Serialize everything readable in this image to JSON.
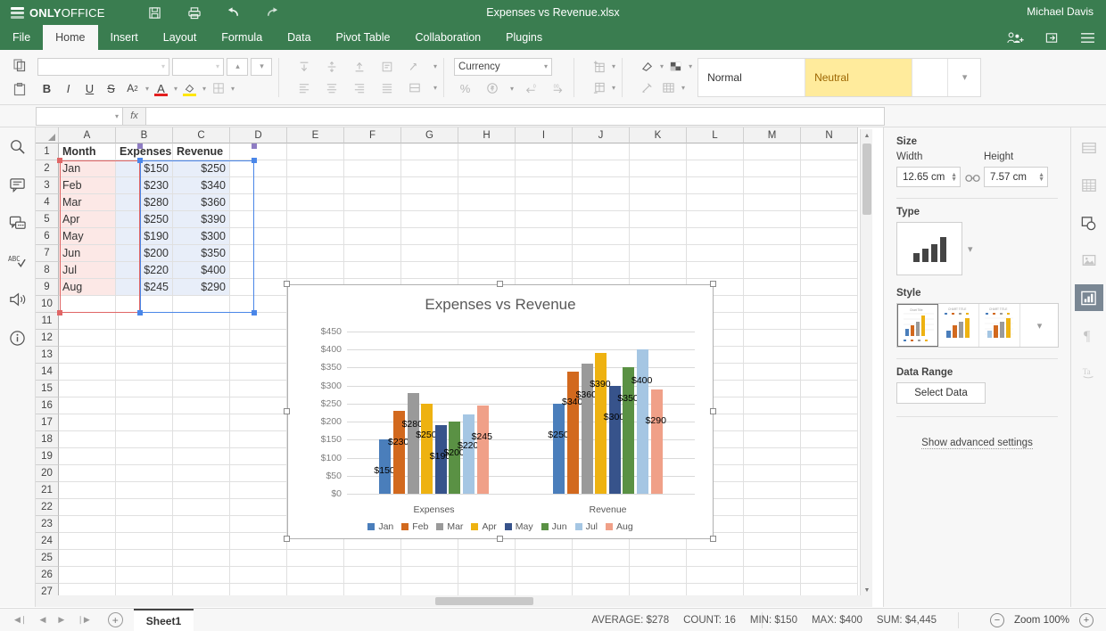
{
  "app": {
    "brand_bold": "ONLY",
    "brand_light": "OFFICE",
    "document_title": "Expenses vs Revenue.xlsx",
    "user_name": "Michael Davis",
    "accent_green": "#3a7d50"
  },
  "quick_access": [
    {
      "name": "save-icon",
      "label": "Save"
    },
    {
      "name": "print-icon",
      "label": "Print"
    },
    {
      "name": "undo-icon",
      "label": "Undo"
    },
    {
      "name": "redo-icon",
      "label": "Redo"
    }
  ],
  "header_actions": [
    {
      "name": "share-users-icon",
      "label": "Share"
    },
    {
      "name": "open-location-icon",
      "label": "Open file location"
    },
    {
      "name": "hamburger-menu-icon",
      "label": "View settings"
    }
  ],
  "menu_tabs": [
    {
      "label": "File",
      "active": false
    },
    {
      "label": "Home",
      "active": true
    },
    {
      "label": "Insert",
      "active": false
    },
    {
      "label": "Layout",
      "active": false
    },
    {
      "label": "Formula",
      "active": false
    },
    {
      "label": "Data",
      "active": false
    },
    {
      "label": "Pivot Table",
      "active": false
    },
    {
      "label": "Collaboration",
      "active": false
    },
    {
      "label": "Plugins",
      "active": false
    }
  ],
  "ribbon": {
    "font_name": "",
    "font_size": "",
    "number_format": "Currency",
    "styles": [
      {
        "label": "Normal",
        "selected": false
      },
      {
        "label": "Neutral",
        "selected": true
      }
    ],
    "buttons": {
      "bold": "B",
      "italic": "I",
      "underline": "U",
      "strikethrough": "S",
      "subscript": "A",
      "font_color": "A",
      "fill_color": "",
      "borders": "",
      "percent": "%",
      "currency": "$"
    }
  },
  "formula_bar": {
    "name_box_value": "",
    "fx_label": "fx",
    "formula_value": ""
  },
  "left_rail": [
    {
      "name": "search-icon",
      "label": "Search"
    },
    {
      "name": "comments-icon",
      "label": "Comments"
    },
    {
      "name": "chat-icon",
      "label": "Chat"
    },
    {
      "name": "spellcheck-icon",
      "label": "Spell checking"
    },
    {
      "name": "feedback-icon",
      "label": "Feedback & Support"
    },
    {
      "name": "about-icon",
      "label": "About"
    }
  ],
  "right_rail": [
    {
      "name": "cell-settings-icon",
      "active": false
    },
    {
      "name": "table-settings-icon",
      "active": false
    },
    {
      "name": "shape-settings-icon",
      "active": false
    },
    {
      "name": "image-settings-icon",
      "active": false
    },
    {
      "name": "chart-settings-icon",
      "active": true
    },
    {
      "name": "paragraph-settings-icon",
      "active": false
    },
    {
      "name": "text-art-settings-icon",
      "active": false
    }
  ],
  "sheet": {
    "columns": [
      "A",
      "B",
      "C",
      "D",
      "E",
      "F",
      "G",
      "H",
      "I",
      "J",
      "K",
      "L",
      "M",
      "N"
    ],
    "rows": [
      1,
      2,
      3,
      4,
      5,
      6,
      7,
      8,
      9,
      10,
      11,
      12,
      13,
      14,
      15,
      16,
      17,
      18,
      19,
      20,
      21,
      22,
      23,
      24,
      25,
      26,
      27
    ],
    "data": [
      {
        "row": 1,
        "a": "Month",
        "b": "Expenses",
        "c": "Revenue",
        "header": true
      },
      {
        "row": 2,
        "a": "Jan",
        "b": "$150",
        "c": "$250",
        "header": false
      },
      {
        "row": 3,
        "a": "Feb",
        "b": "$230",
        "c": "$340",
        "header": false
      },
      {
        "row": 4,
        "a": "Mar",
        "b": "$280",
        "c": "$360",
        "header": false
      },
      {
        "row": 5,
        "a": "Apr",
        "b": "$250",
        "c": "$390",
        "header": false
      },
      {
        "row": 6,
        "a": "May",
        "b": "$190",
        "c": "$300",
        "header": false
      },
      {
        "row": 7,
        "a": "Jun",
        "b": "$200",
        "c": "$350",
        "header": false
      },
      {
        "row": 8,
        "a": "Jul",
        "b": "$220",
        "c": "$400",
        "header": false
      },
      {
        "row": 9,
        "a": "Aug",
        "b": "$245",
        "c": "$290",
        "header": false
      }
    ]
  },
  "chart_data": {
    "type": "bar",
    "title": "Expenses vs Revenue",
    "categories": [
      "Expenses",
      "Revenue"
    ],
    "xlabel": "",
    "ylabel": "",
    "ylim": [
      0,
      450
    ],
    "ytick_step": 50,
    "ytick_labels": [
      "$0",
      "$50",
      "$100",
      "$150",
      "$200",
      "$250",
      "$300",
      "$350",
      "$400",
      "$450"
    ],
    "grid": true,
    "legend_position": "bottom",
    "data_labels": true,
    "series": [
      {
        "name": "Jan",
        "color": "#4a7ebb",
        "values": [
          150,
          250
        ],
        "labels": [
          "$150",
          "$250"
        ]
      },
      {
        "name": "Feb",
        "color": "#d2691e",
        "values": [
          230,
          340
        ],
        "labels": [
          "$230",
          "$340"
        ]
      },
      {
        "name": "Mar",
        "color": "#9a9a9a",
        "values": [
          280,
          360
        ],
        "labels": [
          "$280",
          "$360"
        ]
      },
      {
        "name": "Apr",
        "color": "#eeb211",
        "values": [
          250,
          390
        ],
        "labels": [
          "$250",
          "$390"
        ]
      },
      {
        "name": "May",
        "color": "#37538b",
        "values": [
          190,
          300
        ],
        "labels": [
          "$190",
          "$300"
        ]
      },
      {
        "name": "Jun",
        "color": "#5a9144",
        "values": [
          200,
          350
        ],
        "labels": [
          "$200",
          "$350"
        ]
      },
      {
        "name": "Jul",
        "color": "#a5c6e3",
        "values": [
          220,
          400
        ],
        "labels": [
          "$220",
          "$400"
        ]
      },
      {
        "name": "Aug",
        "color": "#f0a088",
        "values": [
          245,
          290
        ],
        "labels": [
          "$245",
          "$290"
        ]
      }
    ]
  },
  "right_panel": {
    "size_label": "Size",
    "width_label": "Width",
    "height_label": "Height",
    "width_value": "12.65 cm",
    "height_value": "7.57 cm",
    "lock_aspect_name": "link-aspect-ratio-icon",
    "type_label": "Type",
    "style_label": "Style",
    "data_range_label": "Data Range",
    "select_data_label": "Select Data",
    "advanced_label": "Show advanced settings"
  },
  "status_bar": {
    "nav": [
      {
        "name": "first-sheet-button",
        "glyph": "◀❘"
      },
      {
        "name": "prev-sheet-button",
        "glyph": "◀"
      },
      {
        "name": "next-sheet-button",
        "glyph": "▶"
      },
      {
        "name": "last-sheet-button",
        "glyph": "❘▶"
      }
    ],
    "add_sheet": "+",
    "sheet_tab": "Sheet1",
    "stats": [
      "AVERAGE: $278",
      "COUNT: 16",
      "MIN: $150",
      "MAX: $400",
      "SUM: $4,445"
    ],
    "zoom_out": "−",
    "zoom_label": "Zoom 100%",
    "zoom_in": "+"
  }
}
